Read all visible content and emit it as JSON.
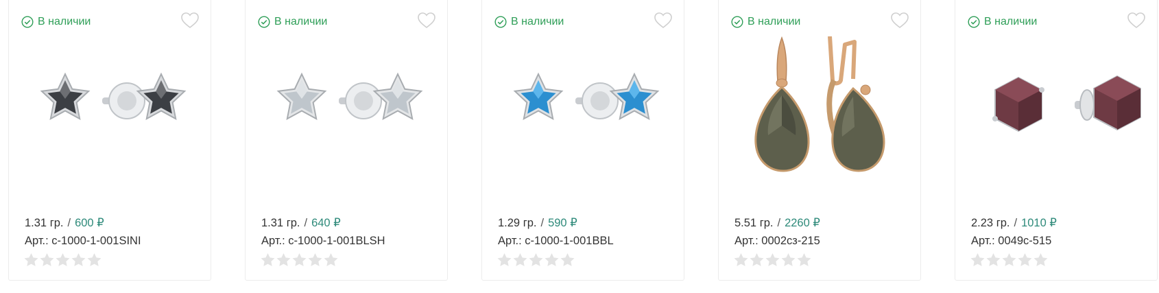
{
  "colors": {
    "stock_green": "#2e9e57",
    "price_teal": "#2e8a7a",
    "star_grey": "#e3e3e3",
    "heart_grey": "#cfcfcf"
  },
  "icons": {
    "stock": "check-circle-icon",
    "favorite": "heart-icon",
    "rating": "star-icon"
  },
  "products": [
    {
      "stock_label": "В наличии",
      "weight": "1.31 гр.",
      "separator": "/",
      "price": "600 ₽",
      "article": "Арт.: c-1000-1-001SINI",
      "rating": 0,
      "image": "star-earrings",
      "stone_color": "#3c3f44"
    },
    {
      "stock_label": "В наличии",
      "weight": "1.31 гр.",
      "separator": "/",
      "price": "640 ₽",
      "article": "Арт.: c-1000-1-001BLSH",
      "rating": 0,
      "image": "star-earrings",
      "stone_color": "#bfc6cc"
    },
    {
      "stock_label": "В наличии",
      "weight": "1.29 гр.",
      "separator": "/",
      "price": "590 ₽",
      "article": "Арт.: c-1000-1-001BBL",
      "rating": 0,
      "image": "star-earrings",
      "stone_color": "#2c8fd0"
    },
    {
      "stock_label": "В наличии",
      "weight": "5.51 гр.",
      "separator": "/",
      "price": "2260 ₽",
      "article": "Арт.: 0002сз-215",
      "rating": 0,
      "image": "drop-earrings",
      "stone_color": "#5d5f4c"
    },
    {
      "stock_label": "В наличии",
      "weight": "2.23 гр.",
      "separator": "/",
      "price": "1010 ₽",
      "article": "Арт.: 0049с-515",
      "rating": 0,
      "image": "cube-earrings",
      "stone_color": "#6e3a44"
    }
  ]
}
